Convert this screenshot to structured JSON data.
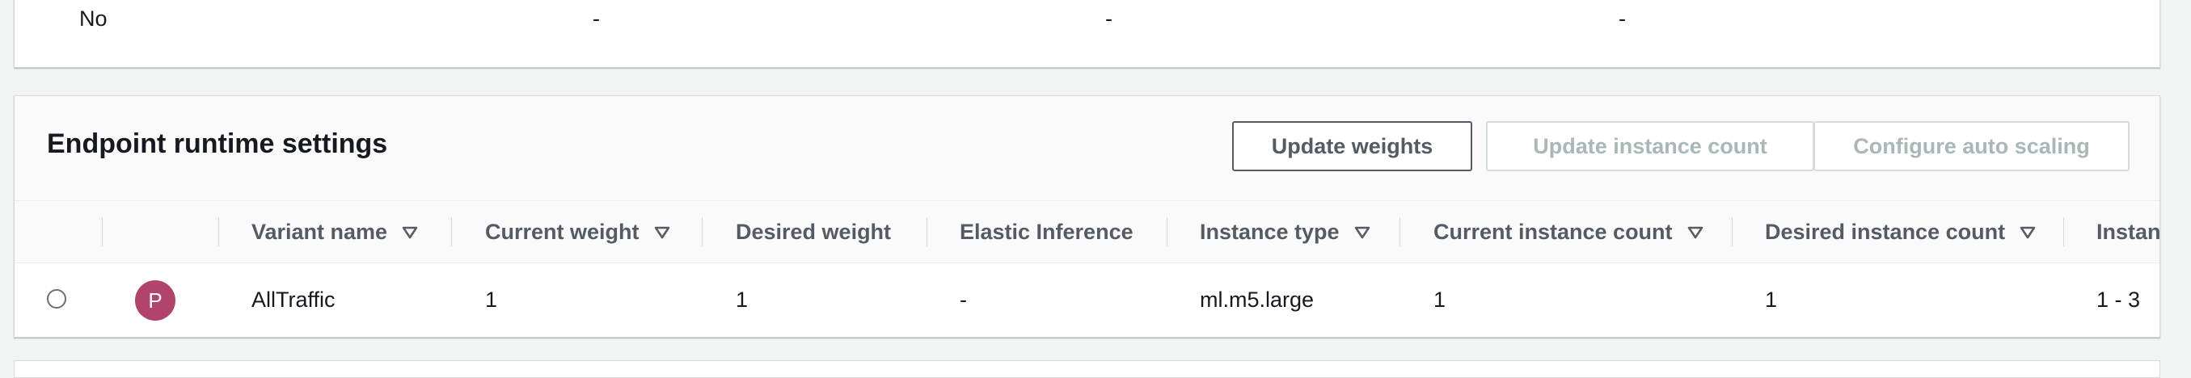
{
  "top_row": {
    "cells": [
      "No",
      "-",
      "-",
      "-"
    ]
  },
  "runtime_settings": {
    "title": "Endpoint runtime settings",
    "buttons": {
      "update_weights": "Update weights",
      "update_instance_count": "Update instance count",
      "configure_auto_scaling": "Configure auto scaling"
    },
    "columns": [
      "Variant name",
      "Current weight",
      "Desired weight",
      "Elastic Inference",
      "Instance type",
      "Current instance count",
      "Desired instance count",
      "Instan"
    ],
    "rows": [
      {
        "avatar_letter": "P",
        "variant_name": "AllTraffic",
        "current_weight": "1",
        "desired_weight": "1",
        "elastic_inference": "-",
        "instance_type": "ml.m5.large",
        "current_instance_count": "1",
        "desired_instance_count": "1",
        "instance_range": "1 - 3"
      }
    ]
  },
  "colors": {
    "avatar": "#b0446c",
    "background": "#f2f3f3"
  }
}
